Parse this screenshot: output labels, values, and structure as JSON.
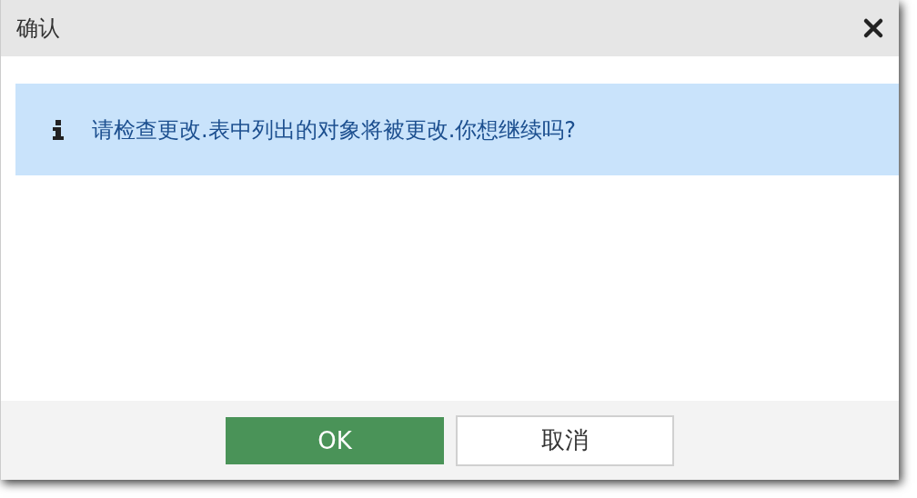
{
  "window": {
    "title": "确认"
  },
  "message": {
    "text": "请检查更改.表中列出的对象将被更改.你想继续吗?"
  },
  "buttons": [
    {
      "label": "OK",
      "kind": "primary"
    },
    {
      "label": "取消",
      "kind": "secondary"
    }
  ]
}
